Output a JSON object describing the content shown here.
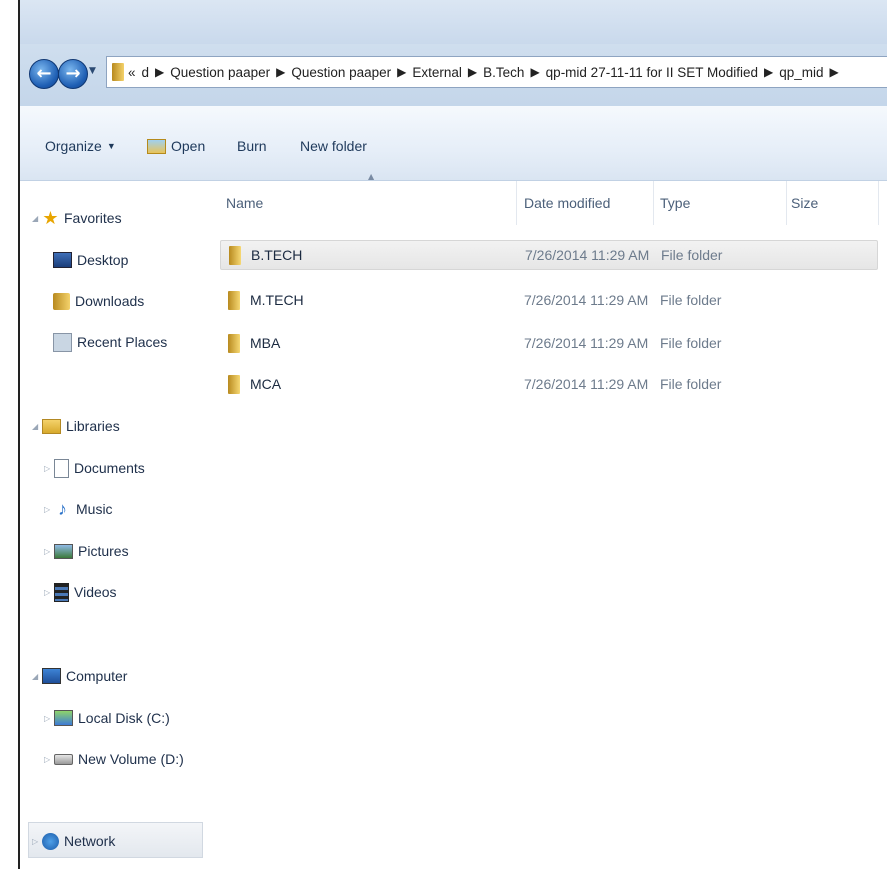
{
  "breadcrumb": {
    "overflow": "«",
    "items": [
      "d",
      "Question paaper",
      "Question paaper",
      "External",
      "B.Tech",
      "qp-mid 27-11-11 for II SET Modified",
      "qp_mid"
    ]
  },
  "toolbar": {
    "organize": "Organize",
    "open": "Open",
    "burn": "Burn",
    "new_folder": "New folder"
  },
  "nav": {
    "favorites": "Favorites",
    "desktop": "Desktop",
    "downloads": "Downloads",
    "recent_places": "Recent Places",
    "libraries": "Libraries",
    "documents": "Documents",
    "music": "Music",
    "pictures": "Pictures",
    "videos": "Videos",
    "computer": "Computer",
    "local_disk": "Local Disk (C:)",
    "new_volume": "New Volume (D:)",
    "network": "Network"
  },
  "columns": {
    "name": "Name",
    "date_modified": "Date modified",
    "type": "Type",
    "size": "Size"
  },
  "files": [
    {
      "name": "B.TECH",
      "date": "7/26/2014 11:29 AM",
      "type": "File folder"
    },
    {
      "name": "M.TECH",
      "date": "7/26/2014 11:29 AM",
      "type": "File folder"
    },
    {
      "name": "MBA",
      "date": "7/26/2014 11:29 AM",
      "type": "File folder"
    },
    {
      "name": "MCA",
      "date": "7/26/2014 11:29 AM",
      "type": "File folder"
    }
  ]
}
